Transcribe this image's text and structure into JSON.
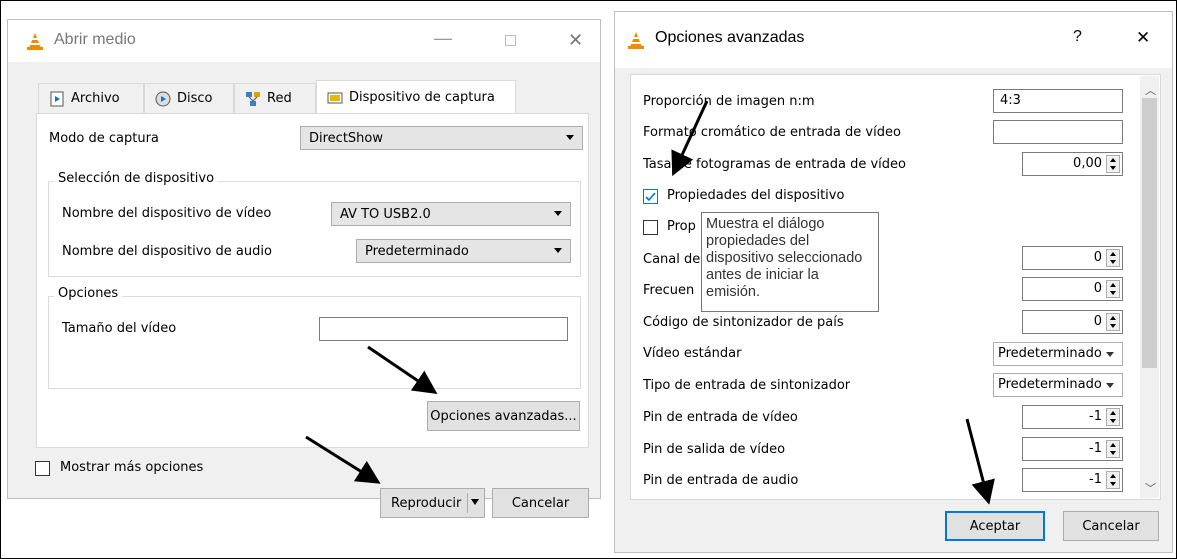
{
  "left_dialog": {
    "title": "Abrir medio",
    "tabs": [
      {
        "label": "Archivo"
      },
      {
        "label": "Disco"
      },
      {
        "label": "Red"
      },
      {
        "label": "Dispositivo de captura"
      }
    ],
    "capture_mode_label": "Modo de captura",
    "capture_mode_value": "DirectShow",
    "device_group_label": "Selección de dispositivo",
    "video_device_label": "Nombre del dispositivo de vídeo",
    "video_device_value": "AV TO USB2.0",
    "audio_device_label": "Nombre del dispositivo de audio",
    "audio_device_value": "Predeterminado",
    "options_group_label": "Opciones",
    "video_size_label": "Tamaño del vídeo",
    "video_size_value": "",
    "advanced_button": "Opciones avanzadas...",
    "more_options_label": "Mostrar más opciones",
    "play_button": "Reproducir",
    "cancel_button": "Cancelar"
  },
  "right_dialog": {
    "title": "Opciones avanzadas",
    "help_glyph": "?",
    "close_glyph": "✕",
    "rows": {
      "aspect_label": "Proporción de imagen n:m",
      "aspect_value": "4:3",
      "chroma_label": "Formato cromático de entrada de vídeo",
      "chroma_value": "",
      "fps_label": "Tasa de fotogramas de entrada de vídeo",
      "fps_value": "0,00",
      "device_props_label": "Propiedades del dispositivo",
      "device_props_checked": true,
      "prop2_label": "Prop",
      "channel_label": "Canal de",
      "channel_value": "0",
      "freq_label": "Frecuen",
      "freq_value": "0",
      "country_label": "Código de sintonizador de país",
      "country_value": "0",
      "video_std_label": "Vídeo estándar",
      "video_std_value": "Predeterminado",
      "tuner_input_label": "Tipo de entrada de sintonizador",
      "tuner_input_value": "Predeterminado",
      "video_in_pin_label": "Pin de entrada de vídeo",
      "video_in_pin_value": "-1",
      "video_out_pin_label": "Pin de salida de vídeo",
      "video_out_pin_value": "-1",
      "audio_in_pin_label": "Pin de entrada de audio",
      "audio_in_pin_value": "-1"
    },
    "tooltip_lines": [
      "Muestra el diálogo",
      "propiedades del",
      "dispositivo seleccionado",
      "antes de iniciar la",
      "emisión."
    ],
    "accept_button": "Aceptar",
    "cancel_button": "Cancelar"
  },
  "colors": {
    "accent": "#0078d7",
    "dialog_bg": "#f0f0f0",
    "cone_orange": "#f08a00"
  }
}
